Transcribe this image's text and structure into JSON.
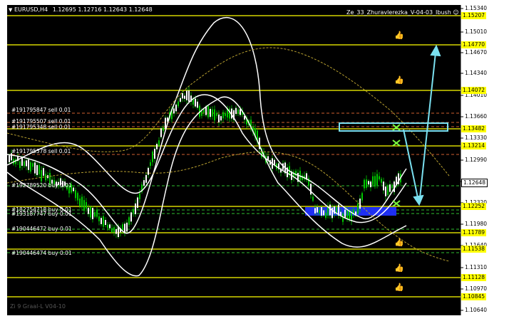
{
  "header": {
    "symbol_timeframe": "EURUSD,H4",
    "ohlc": "1.12695 1.12716 1.12643 1.12648",
    "indicator_name": "Ze_33_Zhuravlerezka_V-04-03_Ibush",
    "menu_icon": "triangle-down-icon",
    "indicator_icon": "smiley-icon"
  },
  "footer": {
    "text": "Zi 9 Graal-L V04-10"
  },
  "price_scale": {
    "ticks": [
      "1.15340",
      "1.15010",
      "1.14670",
      "1.14340",
      "1.14010",
      "1.13660",
      "1.13330",
      "1.12990",
      "1.12648",
      "1.12320",
      "1.11980",
      "1.11640",
      "1.11310",
      "1.10970",
      "1.10640"
    ],
    "levels": [
      "1.15207",
      "1.14770",
      "1.14072",
      "1.13482",
      "1.13214",
      "1.12252",
      "1.11789",
      "1.11538",
      "1.11128",
      "1.10845"
    ],
    "current_price": "1.12648"
  },
  "orders": [
    {
      "id": "#191795847",
      "type": "sell",
      "lots": "0.01"
    },
    {
      "id": "#191795507",
      "type": "sell",
      "lots": "0.01"
    },
    {
      "id": "#191795348",
      "type": "sell",
      "lots": "0.01"
    },
    {
      "id": "#191795378",
      "type": "sell",
      "lots": "0.01"
    },
    {
      "id": "#192789520",
      "type": "buy",
      "lots": "0.01"
    },
    {
      "id": "#182754718",
      "type": "buy",
      "lots": "0.01"
    },
    {
      "id": "#193187747",
      "type": "buy",
      "lots": "0.01"
    },
    {
      "id": "#190446472",
      "type": "buy",
      "lots": "0.01"
    },
    {
      "id": "#190446474",
      "type": "buy",
      "lots": "0.01"
    }
  ],
  "colors": {
    "background": "#000000",
    "level_line": "#ffff00",
    "candle_up": "#00c800",
    "band": "#ffffff",
    "forecast_arrow": "#7ae0f0",
    "zone": "#2030ff"
  }
}
